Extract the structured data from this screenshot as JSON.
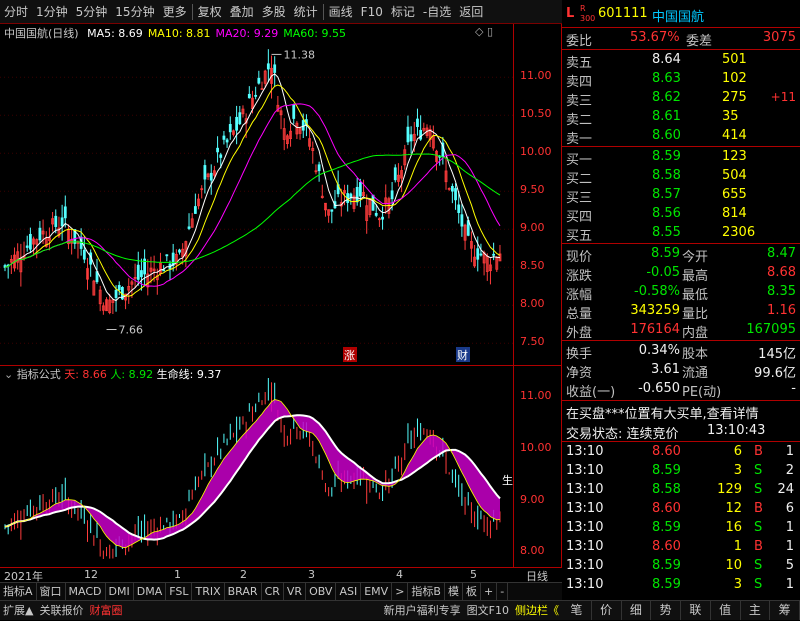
{
  "toolbar": {
    "items": [
      "分时",
      "1分钟",
      "5分钟",
      "15分钟",
      "更多",
      "复权",
      "叠加",
      "多股",
      "统计",
      "画线",
      "F10",
      "标记",
      "-自选",
      "返回"
    ]
  },
  "main_chart": {
    "title": "中国国航(日线)",
    "ma_labels": [
      {
        "text": "MA5: 8.69",
        "color": "#ffffff"
      },
      {
        "text": "MA10: 8.81",
        "color": "#ffff00"
      },
      {
        "text": "MA20: 9.29",
        "color": "#ff00ff"
      },
      {
        "text": "MA60: 9.55",
        "color": "#00ff00"
      }
    ],
    "high_mark": "11.38",
    "low_mark": "7.66",
    "tag_zhang": "涨",
    "tag_cai": "财",
    "price_ticks": [
      "11.00",
      "10.50",
      "10.00",
      "9.50",
      "9.00",
      "8.50",
      "8.00",
      "7.50"
    ]
  },
  "indicator": {
    "title": "指标公式",
    "tian_label": "天: 8.66",
    "ren_label": "人: 8.92",
    "life_label": "生命线: 9.37",
    "end_label": "生",
    "ticks": [
      "11.00",
      "10.00",
      "9.00",
      "8.00"
    ]
  },
  "time_axis": {
    "labels": [
      "2021年",
      "12",
      "1",
      "2",
      "3",
      "4",
      "5"
    ],
    "right_label": "日线"
  },
  "tabs": [
    "指标A",
    "窗口",
    "MACD",
    "DMI",
    "DMA",
    "FSL",
    "TRIX",
    "BRAR",
    "CR",
    "VR",
    "OBV",
    "ASI",
    "EMV",
    ">",
    "指标B",
    "模",
    "板",
    "+",
    "-"
  ],
  "bottom": {
    "left": [
      "扩展▲",
      "关联报价",
      "财富圈"
    ],
    "right": [
      "新用户福利专享",
      "图文F10",
      "侧边栏《"
    ],
    "right_tabs": [
      "笔",
      "价",
      "细",
      "势",
      "联",
      "值",
      "主",
      "筹"
    ]
  },
  "quote": {
    "code_prefix": "L",
    "code_sup": "R",
    "code_sub": "300",
    "code": "601111",
    "name": "中国国航",
    "weibi_label": "委比",
    "weibi": "53.67%",
    "weicha_label": "委差",
    "weicha": "3075",
    "sells": [
      {
        "label": "卖五",
        "price": "8.64",
        "vol": "501",
        "extra": ""
      },
      {
        "label": "卖四",
        "price": "8.63",
        "vol": "102",
        "extra": ""
      },
      {
        "label": "卖三",
        "price": "8.62",
        "vol": "275",
        "extra": "+11"
      },
      {
        "label": "卖二",
        "price": "8.61",
        "vol": "35",
        "extra": ""
      },
      {
        "label": "卖一",
        "price": "8.60",
        "vol": "414",
        "extra": ""
      }
    ],
    "buys": [
      {
        "label": "买一",
        "price": "8.59",
        "vol": "123"
      },
      {
        "label": "买二",
        "price": "8.58",
        "vol": "504"
      },
      {
        "label": "买三",
        "price": "8.57",
        "vol": "655"
      },
      {
        "label": "买四",
        "price": "8.56",
        "vol": "814"
      },
      {
        "label": "买五",
        "price": "8.55",
        "vol": "2306"
      }
    ],
    "stats": [
      {
        "l1": "现价",
        "v1": "8.59",
        "c1": "green",
        "l2": "今开",
        "v2": "8.47",
        "c2": "green"
      },
      {
        "l1": "涨跌",
        "v1": "-0.05",
        "c1": "green",
        "l2": "最高",
        "v2": "8.68",
        "c2": "red"
      },
      {
        "l1": "涨幅",
        "v1": "-0.58%",
        "c1": "green",
        "l2": "最低",
        "v2": "8.35",
        "c2": "green"
      },
      {
        "l1": "总量",
        "v1": "343259",
        "c1": "yellow",
        "l2": "量比",
        "v2": "1.16",
        "c2": "red"
      },
      {
        "l1": "外盘",
        "v1": "176164",
        "c1": "red",
        "l2": "内盘",
        "v2": "167095",
        "c2": "green"
      }
    ],
    "stats2": [
      {
        "l1": "换手",
        "v1": "0.34%",
        "l2": "股本",
        "v2": "145亿"
      },
      {
        "l1": "净资",
        "v1": "3.61",
        "l2": "流通",
        "v2": "99.6亿"
      },
      {
        "l1": "收益(一)",
        "v1": "-0.650",
        "l2": "PE(动)",
        "v2": "-"
      }
    ],
    "notice": "在买盘***位置有大买单,查看详情",
    "status": "交易状态: 连续竞价",
    "status_time": "13:10:43",
    "ticks": [
      {
        "t": "13:10",
        "p": "8.60",
        "pc": "red",
        "v": "6",
        "s": "B",
        "sc": "red",
        "n": "1"
      },
      {
        "t": "13:10",
        "p": "8.59",
        "pc": "green",
        "v": "3",
        "s": "S",
        "sc": "green",
        "n": "2"
      },
      {
        "t": "13:10",
        "p": "8.58",
        "pc": "green",
        "v": "129",
        "s": "S",
        "sc": "green",
        "n": "24"
      },
      {
        "t": "13:10",
        "p": "8.60",
        "pc": "red",
        "v": "12",
        "s": "B",
        "sc": "red",
        "n": "6"
      },
      {
        "t": "13:10",
        "p": "8.59",
        "pc": "green",
        "v": "16",
        "s": "S",
        "sc": "green",
        "n": "1"
      },
      {
        "t": "13:10",
        "p": "8.60",
        "pc": "red",
        "v": "1",
        "s": "B",
        "sc": "red",
        "n": "1"
      },
      {
        "t": "13:10",
        "p": "8.59",
        "pc": "green",
        "v": "10",
        "s": "S",
        "sc": "green",
        "n": "5"
      },
      {
        "t": "13:10",
        "p": "8.59",
        "pc": "green",
        "v": "3",
        "s": "S",
        "sc": "green",
        "n": "1"
      }
    ]
  }
}
